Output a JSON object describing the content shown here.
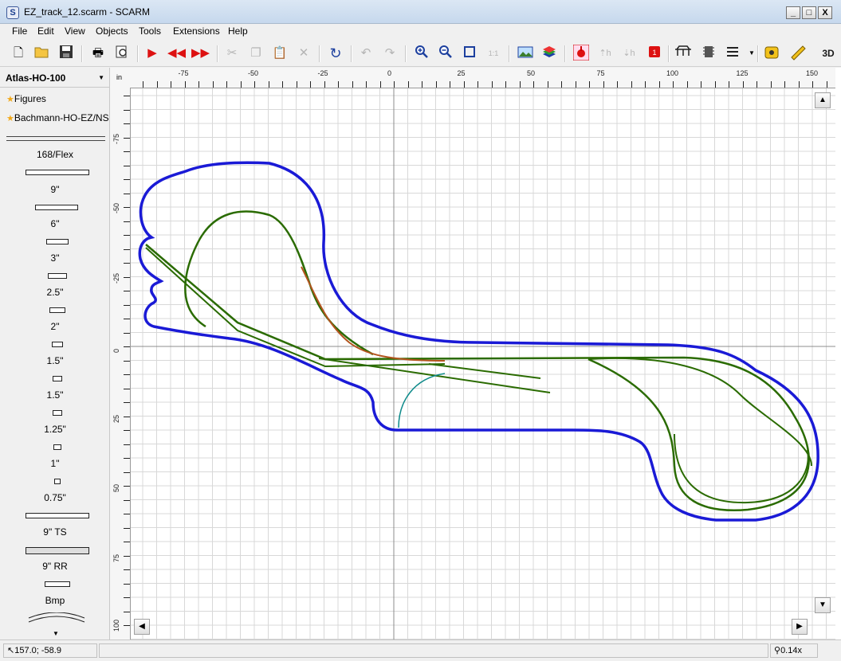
{
  "window": {
    "title": "EZ_track_12.scarm - SCARM",
    "minimize": "_",
    "maximize": "□",
    "close": "X"
  },
  "menu": [
    "File",
    "Edit",
    "View",
    "Objects",
    "Tools",
    "Extensions",
    "Help"
  ],
  "toolbar": {
    "icons": [
      "new-file-icon",
      "open-folder-icon",
      "save-icon",
      "print-icon",
      "print-preview-icon",
      "play-icon",
      "rewind-icon",
      "fast-forward-icon",
      "cut-icon",
      "copy-icon",
      "paste-icon",
      "delete-icon",
      "rotate-icon",
      "undo-icon",
      "redo-icon",
      "zoom-in-icon",
      "zoom-out-icon",
      "zoom-fit-icon",
      "zoom-1to1-icon",
      "background-image-icon",
      "layers-icon",
      "track-height-icon",
      "elevation-up-icon",
      "elevation-down-icon",
      "connector-icon",
      "bridge-icon",
      "tunnel-icon",
      "parallel-tracks-icon",
      "measure-tape-icon",
      "ruler-icon",
      "3d-view-icon"
    ],
    "view3d_label": "3D"
  },
  "sidebar": {
    "library": "Atlas-HO-100",
    "links": [
      "Figures",
      "Bachmann-HO-EZ/NS"
    ],
    "parts": [
      "168/Flex",
      "9\"",
      "6\"",
      "3\"",
      "2.5\"",
      "2\"",
      "1.5\"",
      "1.5\"",
      "1.25\"",
      "1\"",
      "0.75\"",
      "9\" TS",
      "9\" RR",
      "Bmp"
    ]
  },
  "ruler": {
    "unit": "in",
    "x_labels": [
      "-75",
      "-50",
      "-25",
      "0",
      "25",
      "50",
      "75",
      "100",
      "125",
      "150"
    ],
    "y_labels": [
      "-75",
      "-50",
      "-25",
      "0",
      "25",
      "50",
      "75",
      "100"
    ]
  },
  "colors": {
    "table_outline": "#1a1ad6",
    "track_main": "#2a6b00",
    "track_siding": "#b3541e",
    "track_spur": "#0d8a8a",
    "grid": "#d8d8d8",
    "axis": "#8c8c8c"
  },
  "status": {
    "cursor_coords": "157.0; -58.9",
    "zoom": "0.14x"
  }
}
